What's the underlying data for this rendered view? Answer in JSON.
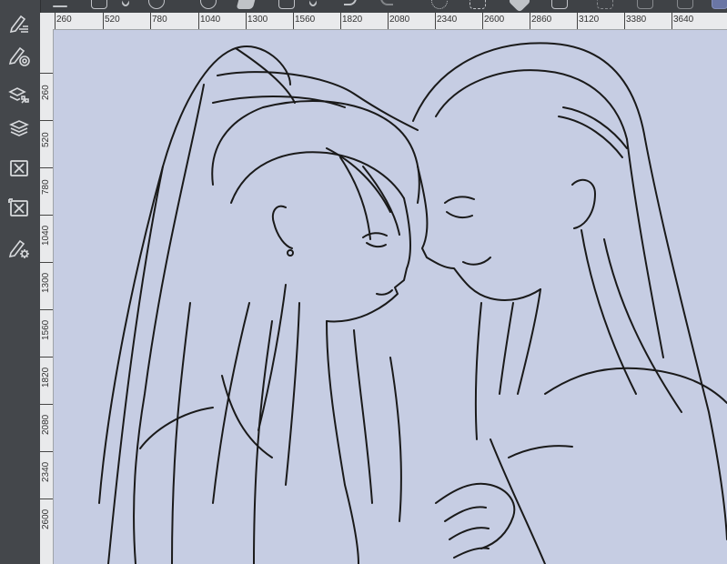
{
  "toolbar": {
    "icons": [
      "menu-icon",
      "new-layer-icon",
      "chevron-down-icon",
      "layer-mask-icon",
      "add-layer-icon",
      "eraser-icon",
      "fill-icon",
      "chevron-down-icon",
      "undo-icon",
      "redo-icon",
      "loading-icon",
      "transform-icon",
      "fill-bucket-icon",
      "crop-icon",
      "ruler-icon",
      "selection-icon",
      "gradient-icon",
      "frame-icon"
    ]
  },
  "sidebar": {
    "items": [
      {
        "icon": "pen-layer-icon"
      },
      {
        "icon": "pen-target-icon"
      },
      {
        "icon": "layer-settings-icon"
      },
      {
        "icon": "layers-icon"
      },
      {
        "icon": "clear-layer-icon"
      },
      {
        "icon": "clear-selection-icon"
      },
      {
        "icon": "pen-settings-icon"
      }
    ]
  },
  "ruler": {
    "horizontal": [
      "260",
      "520",
      "780",
      "1040",
      "1300",
      "1560",
      "1820",
      "2080",
      "2340",
      "2600",
      "2860",
      "3120",
      "3380",
      "3640"
    ],
    "vertical": [
      "260",
      "520",
      "780",
      "1040",
      "1300",
      "1560",
      "1820",
      "2080",
      "2340",
      "2600"
    ]
  },
  "canvas": {
    "background": "#c6cde3",
    "line_color": "#1a1a1a"
  }
}
